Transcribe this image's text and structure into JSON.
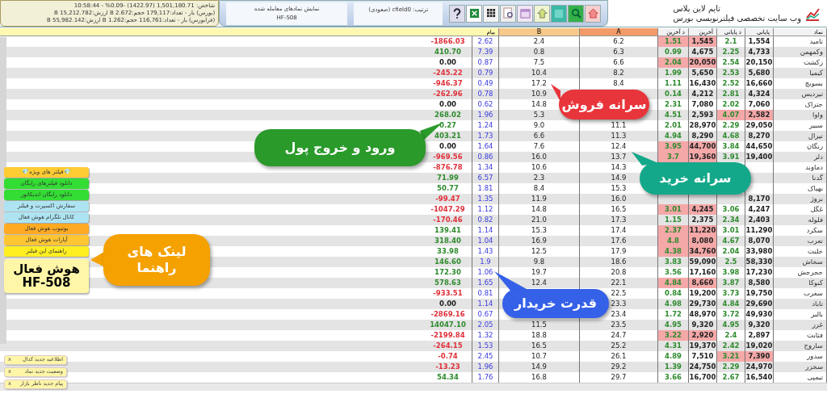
{
  "header": {
    "market_lines": [
      "شاخص: 1,501,180.71 (1422.97) -0.09% - 10:58:44",
      "(بورس) بار - تعداد:179,117 حجم:2.672 B ارزش:15,212.782 B",
      "(فرابورس) بار - تعداد:116,761 حجم:1.262 B ارزش:55,982.142 B"
    ],
    "view_label": "نمایش نمادهای معامله شده",
    "filter_code": "HF-508",
    "sort_label": "ترتیب: cfield0 (صعودی)",
    "brand_title": "تایم لاین پلاس",
    "brand_subtitle": "وب سایت تخصصی فیلترنویسی بورس"
  },
  "table": {
    "columns": [
      null,
      "بیام",
      "B",
      "A",
      "د آخرین",
      "آخرین",
      "د پایانی",
      "پایانی",
      "نماد"
    ],
    "rows": [
      {
        "cells": [
          {
            "text": "-1866.03",
            "color": "#e0303a"
          },
          "2.62",
          "2.4",
          "6.2",
          "1.51",
          "1,545",
          "2.1",
          "1,554",
          "تامید"
        ],
        "close_alert": false,
        "last_alert": true
      },
      {
        "cells": [
          {
            "text": "410.70",
            "color": "#2e8b2e"
          },
          "7.39",
          "0.8",
          "6.3",
          "0.99",
          "4,675",
          "2.25",
          "4,733",
          "وکمهمن"
        ],
        "close_alert": false,
        "last_alert": false
      },
      {
        "cells": [
          {
            "text": "0.00",
            "color": "#222222"
          },
          "0.87",
          "7.5",
          "6.6",
          "2.04",
          "20,050",
          "2.54",
          "20,150",
          "زکشت"
        ],
        "close_alert": false,
        "last_alert": true
      },
      {
        "cells": [
          {
            "text": "-245.22",
            "color": "#e0303a"
          },
          "0.79",
          "10.4",
          "8.2",
          "1.99",
          "5,650",
          "2.53",
          "5,680",
          "کیمیا"
        ],
        "close_alert": false,
        "last_alert": false
      },
      {
        "cells": [
          {
            "text": "-946.37",
            "color": "#e0303a"
          },
          "0.49",
          "17.2",
          "8.4",
          "1.11",
          "16,430",
          "2.52",
          "16,660",
          "بسویچ"
        ],
        "close_alert": false,
        "last_alert": false
      },
      {
        "cells": [
          {
            "text": "-262.96",
            "color": "#e0303a"
          },
          "0.78",
          "10.9",
          null,
          "0.14",
          "4,212",
          "2.81",
          "4,324",
          "تیردیس"
        ],
        "close_alert": false,
        "last_alert": false
      },
      {
        "cells": [
          {
            "text": "0.00",
            "color": "#222222"
          },
          "0.62",
          "14.8",
          null,
          "2.31",
          "7,080",
          "2.02",
          "7,060",
          "حتراک"
        ],
        "close_alert": false,
        "last_alert": false
      },
      {
        "cells": [
          {
            "text": "268.02",
            "color": "#2e8b2e"
          },
          "1.96",
          "5.3",
          null,
          "4.51",
          "2,593",
          "4.07",
          "2,582",
          "واوا"
        ],
        "close_alert": true,
        "last_alert": false
      },
      {
        "cells": [
          {
            "text": "0.27",
            "color": "#2e8b2e"
          },
          "1.24",
          "9.0",
          "11.1",
          "2.01",
          "28,970",
          "2.29",
          "29,050",
          "سبیر"
        ],
        "close_alert": false,
        "last_alert": false
      },
      {
        "cells": [
          {
            "text": "403.21",
            "color": "#2e8b2e"
          },
          "1.73",
          "6.6",
          "11.3",
          "4.94",
          "8,290",
          "4.68",
          "8,270",
          "تیرال"
        ],
        "close_alert": false,
        "last_alert": false
      },
      {
        "cells": [
          {
            "text": "0.00",
            "color": "#222222"
          },
          "1.64",
          "7.6",
          "12.4",
          "3.95",
          "44,700",
          "3.84",
          "44,650",
          "رنگان"
        ],
        "close_alert": false,
        "last_alert": true
      },
      {
        "cells": [
          {
            "text": "-969.56",
            "color": "#e0303a"
          },
          "0.86",
          "16.0",
          "13.7",
          "3.7",
          "19,360",
          "3.91",
          "19,400",
          "دلر"
        ],
        "close_alert": false,
        "last_alert": true
      },
      {
        "cells": [
          {
            "text": "-876.78",
            "color": "#e0303a"
          },
          "1.34",
          "10.6",
          "14.3",
          null,
          null,
          null,
          null,
          "دماوند"
        ]
      },
      {
        "cells": [
          {
            "text": "71.99",
            "color": "#2e8b2e"
          },
          "6.57",
          "2.3",
          "14.9",
          null,
          null,
          null,
          null,
          "گدنا"
        ]
      },
      {
        "cells": [
          {
            "text": "50.77",
            "color": "#2e8b2e"
          },
          "1.81",
          "8.4",
          "15.3",
          null,
          null,
          null,
          null,
          "بهپاک"
        ]
      },
      {
        "cells": [
          {
            "text": "-99.47",
            "color": "#e0303a"
          },
          "1.35",
          "11.9",
          "16.0",
          null,
          null,
          null,
          "8,170",
          "نروژ"
        ],
        "close_alert": false
      },
      {
        "cells": [
          {
            "text": "-1047.29",
            "color": "#e0303a"
          },
          "1.12",
          "14.8",
          "16.5",
          "3.01",
          "4,245",
          "3.06",
          "4,247",
          "غگل"
        ],
        "close_alert": false,
        "last_alert": true
      },
      {
        "cells": [
          {
            "text": "-170.46",
            "color": "#e0303a"
          },
          "0.82",
          "21.0",
          "17.3",
          "1.15",
          "2,375",
          "2.34",
          "2,403",
          "فلوله"
        ],
        "close_alert": false,
        "last_alert": false
      },
      {
        "cells": [
          {
            "text": "139.41",
            "color": "#2e8b2e"
          },
          "1.14",
          "15.3",
          "17.4",
          "2.37",
          "11,220",
          "3.01",
          "11,290",
          "سکرد"
        ],
        "close_alert": false,
        "last_alert": true
      },
      {
        "cells": [
          {
            "text": "318.40",
            "color": "#2e8b2e"
          },
          "1.04",
          "16.9",
          "17.6",
          "4.8",
          "8,080",
          "4.67",
          "8,070",
          "تعرب"
        ],
        "close_alert": false,
        "last_alert": true
      },
      {
        "cells": [
          {
            "text": "33.98",
            "color": "#2e8b2e"
          },
          "1.43",
          "12.5",
          "17.9",
          "4.38",
          "34,760",
          "2.04",
          "33,980",
          "خلنت"
        ],
        "close_alert": false,
        "last_alert": true
      },
      {
        "cells": [
          {
            "text": "146.60",
            "color": "#2e8b2e"
          },
          "1.9",
          "9.8",
          "18.6",
          "3.83",
          "59,090",
          "2.5",
          "58,330",
          "سخاش"
        ],
        "close_alert": false,
        "last_alert": false
      },
      {
        "cells": [
          {
            "text": "172.30",
            "color": "#2e8b2e"
          },
          "1.06",
          "19.7",
          "20.8",
          "3.56",
          "17,160",
          "3.98",
          "17,230",
          "حجرجش"
        ],
        "close_alert": false,
        "last_alert": false
      },
      {
        "cells": [
          {
            "text": "578.63",
            "color": "#2e8b2e"
          },
          "1.65",
          "12.4",
          "22.1",
          "4.84",
          "8,660",
          "3.87",
          "8,580",
          "کنوکا"
        ],
        "close_alert": false,
        "last_alert": true
      },
      {
        "cells": [
          {
            "text": "-933.51",
            "color": "#e0303a"
          },
          "0.81",
          null,
          "22.5",
          "0.84",
          "19,200",
          "3.73",
          "19,750",
          "سغرب"
        ],
        "close_alert": false,
        "last_alert": false
      },
      {
        "cells": [
          {
            "text": "0.00",
            "color": "#222222"
          },
          "1.14",
          null,
          "23.3",
          "4.98",
          "29,730",
          "4.84",
          "29,690",
          "تاباد"
        ],
        "close_alert": false,
        "last_alert": false
      },
      {
        "cells": [
          {
            "text": "-2869.16",
            "color": "#e0303a"
          },
          "0.67",
          null,
          "23.4",
          "1.72",
          "48,970",
          "3.72",
          "49,930",
          "بالبر"
        ],
        "close_alert": false,
        "last_alert": false
      },
      {
        "cells": [
          {
            "text": "14047.10",
            "color": "#2e8b2e"
          },
          "2.05",
          "11.5",
          "23.5",
          "4.95",
          "9,320",
          "4.95",
          "9,320",
          "غرر"
        ],
        "close_alert": false,
        "last_alert": false
      },
      {
        "cells": [
          {
            "text": "-2199.84",
            "color": "#e0303a"
          },
          "1.32",
          "18.8",
          "24.7",
          "3.22",
          "2,920",
          "2.4",
          "2,897",
          "فثابت"
        ],
        "close_alert": false,
        "last_alert": true
      },
      {
        "cells": [
          {
            "text": "-264.15",
            "color": "#e0303a"
          },
          "1.53",
          "16.5",
          "25.2",
          "4.31",
          "19,370",
          "2.42",
          "19,020",
          "ساروج"
        ],
        "close_alert": false,
        "last_alert": false
      },
      {
        "cells": [
          {
            "text": "-0.74",
            "color": "#e0303a"
          },
          "2.45",
          "10.7",
          "26.1",
          "4.89",
          "7,510",
          "3.21",
          "7,390",
          "سدور"
        ],
        "close_alert": true,
        "last_alert": false
      },
      {
        "cells": [
          {
            "text": "-13.23",
            "color": "#e0303a"
          },
          "1.96",
          "14.9",
          "29.2",
          "1.39",
          "24,750",
          "2.29",
          "24,970",
          "سخزر"
        ],
        "close_alert": false,
        "last_alert": false
      },
      {
        "cells": [
          {
            "text": "54.34",
            "color": "#2e8b2e"
          },
          "1.76",
          "16.8",
          "29.7",
          "3.66",
          "16,700",
          "2.67",
          "16,540",
          "تیمپی"
        ],
        "close_alert": false,
        "last_alert": false
      }
    ]
  },
  "links": [
    {
      "label": "💎فیلتر های ویژه💎",
      "color": "#ffcc33"
    },
    {
      "label": "دانلود فیلترهای رایگان",
      "color": "#33dd33"
    },
    {
      "label": "دانلود رایگان اندیکاتور",
      "color": "#33dd33"
    },
    {
      "label": "سفارش اکسپرت و فیلتر",
      "color": "#aee4f2"
    },
    {
      "label": "کانال تلگرام هوش فعال",
      "color": "#aee4f2"
    },
    {
      "label": "یوتیوب هوش فعال",
      "color": "#ffaa22"
    },
    {
      "label": "آپارات هوش فعال",
      "color": "#ffc533"
    },
    {
      "label": "راهنمای این فیلتر",
      "color": "#ffee22"
    }
  ],
  "brand_card": {
    "title": "هوش فعال",
    "code": "HF-508"
  },
  "notices": [
    {
      "text": "اطلاعیه جدید کدال",
      "close": "x"
    },
    {
      "text": "وضعیت جدید نماد",
      "close": "x"
    },
    {
      "text": "پیام جدید ناظر بازار",
      "close": "x"
    }
  ],
  "callouts": [
    {
      "text": "سرانه فروش",
      "color": "#e8353b"
    },
    {
      "text": "ورود و خروج پول",
      "color": "#2a9a2a"
    },
    {
      "text": "سرانه خرید",
      "color": "#14a88a"
    },
    {
      "text": "لینک های راهنما",
      "color": "#f5a100"
    },
    {
      "text": "قدرت خریدار",
      "color": "#3560e8"
    }
  ]
}
